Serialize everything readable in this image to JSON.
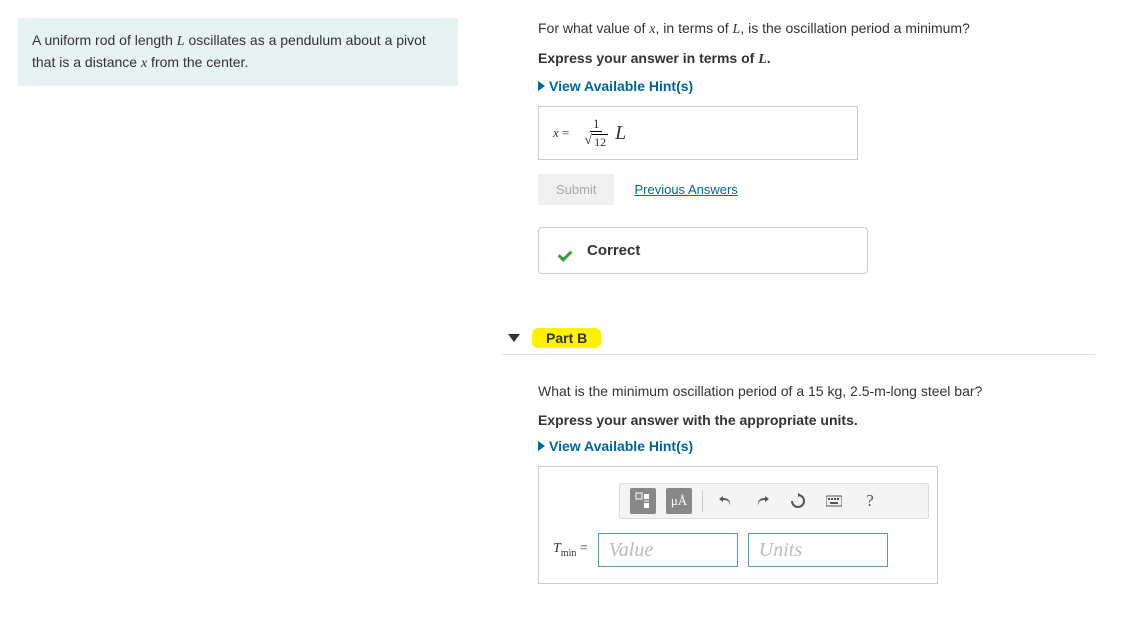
{
  "problem": {
    "intro_1": "A uniform rod of length ",
    "L": "L",
    "intro_2": " oscillates as a pendulum about a pivot that is a distance ",
    "x": "x",
    "intro_3": " from the center."
  },
  "partA": {
    "q_1": "For what value of ",
    "q_x": "x",
    "q_2": ", in terms of ",
    "q_L": "L",
    "q_3": ", is the oscillation period a minimum?",
    "instruction_1": "Express your answer in terms of ",
    "instruction_L": "L",
    "instruction_2": ".",
    "hint_label": "View Available Hint(s)",
    "answer": {
      "lhs": "x",
      "eq": "=",
      "numerator": "1",
      "radicand": "12",
      "trailing": "L"
    },
    "submit_label": "Submit",
    "prev_answers_label": "Previous Answers",
    "correct_label": "Correct"
  },
  "partB": {
    "header": "Part B",
    "q_1": "What is the minimum oscillation period of a ",
    "mass": "15 kg",
    "q_2": ", ",
    "length": "2.5-m",
    "q_3": "-long steel bar?",
    "instruction": "Express your answer with the appropriate units.",
    "hint_label": "View Available Hint(s)",
    "toolbar": {
      "units_btn": "μÅ",
      "help_btn": "?"
    },
    "input": {
      "lhs": "T",
      "sub": "min",
      "eq": "=",
      "value_placeholder": "Value",
      "units_placeholder": "Units"
    }
  },
  "chart_data": null
}
